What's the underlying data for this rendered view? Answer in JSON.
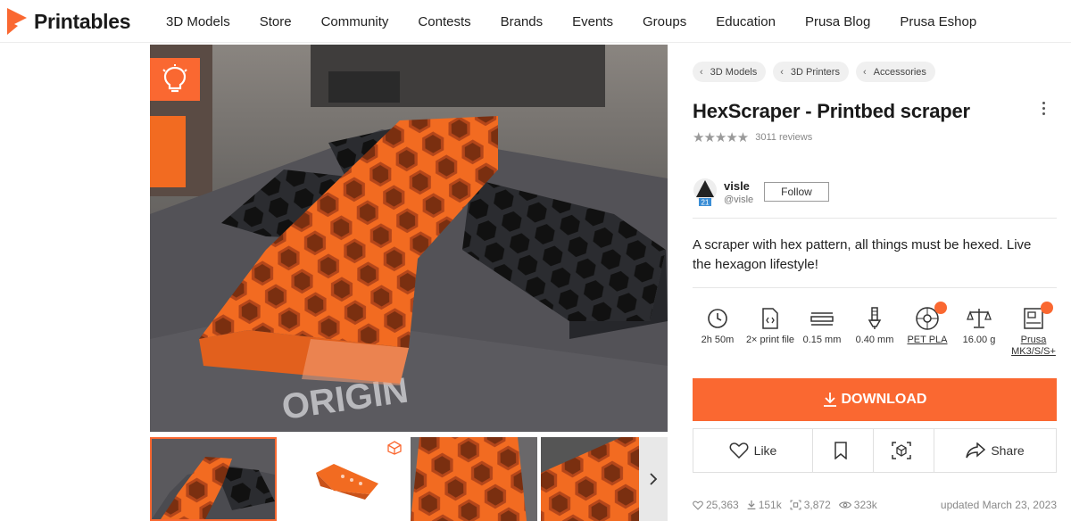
{
  "brand": {
    "name": "Printables",
    "accent": "#fa6831"
  },
  "nav": [
    "3D Models",
    "Store",
    "Community",
    "Contests",
    "Brands",
    "Events",
    "Groups",
    "Education",
    "Prusa Blog",
    "Prusa Eshop"
  ],
  "breadcrumbs": [
    "3D Models",
    "3D Printers",
    "Accessories"
  ],
  "model": {
    "title": "HexScraper - Printbed scraper",
    "rating": 4.5,
    "reviews": "3011 reviews",
    "description": "A scraper with hex pattern, all things must be hexed. Live the hexagon lifestyle!"
  },
  "author": {
    "name": "visle",
    "handle": "@visle",
    "level": "21",
    "follow_label": "Follow"
  },
  "params": [
    {
      "icon": "clock-icon",
      "label": "2h 50m",
      "link": false
    },
    {
      "icon": "file-icon",
      "label": "2× print file",
      "link": false
    },
    {
      "icon": "layer-height-icon",
      "label": "0.15 mm",
      "link": false
    },
    {
      "icon": "nozzle-icon",
      "label": "0.40 mm",
      "link": false
    },
    {
      "icon": "filament-spool-icon",
      "label": "PET PLA",
      "link": true
    },
    {
      "icon": "scale-icon",
      "label": "16.00 g",
      "link": false
    },
    {
      "icon": "printer-icon",
      "label": "Prusa MK3/S/S+",
      "link": true
    }
  ],
  "download_label": "DOWNLOAD",
  "actions": {
    "like": "Like",
    "share": "Share"
  },
  "stats": {
    "likes": "25,363",
    "downloads": "151k",
    "makes": "3,872",
    "views": "323k",
    "updated": "updated March 23, 2023"
  }
}
